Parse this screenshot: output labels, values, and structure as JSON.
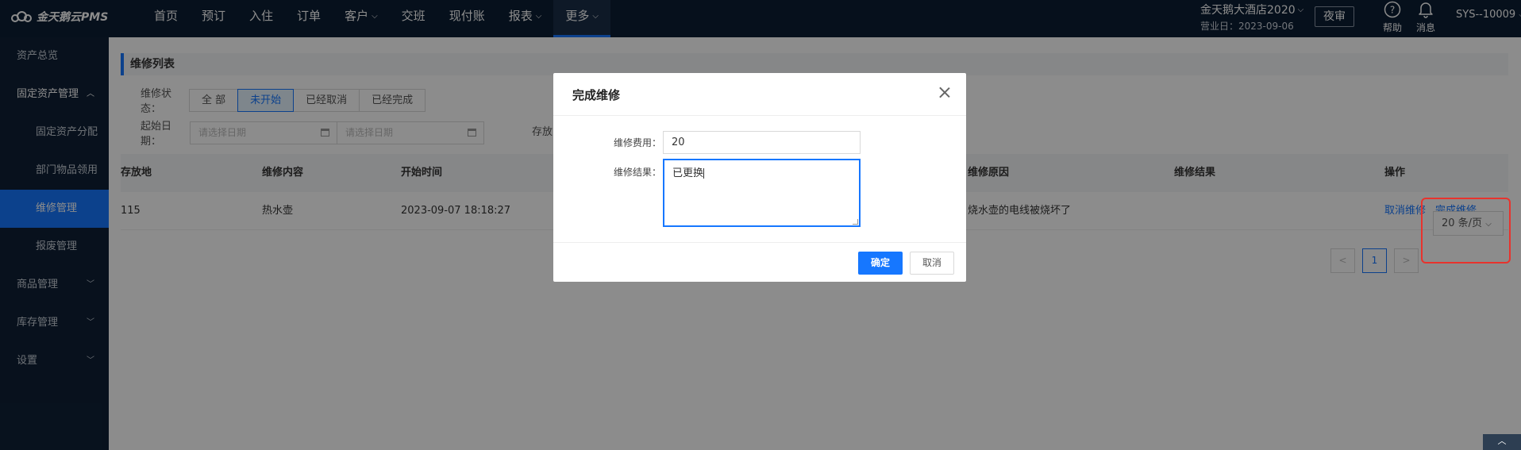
{
  "brand": {
    "name": "金天鹅云PMS"
  },
  "nav": [
    {
      "label": "首页",
      "has_dropdown": false
    },
    {
      "label": "预订",
      "has_dropdown": false
    },
    {
      "label": "入住",
      "has_dropdown": false
    },
    {
      "label": "订单",
      "has_dropdown": false
    },
    {
      "label": "客户",
      "has_dropdown": true
    },
    {
      "label": "交班",
      "has_dropdown": false
    },
    {
      "label": "现付账",
      "has_dropdown": false
    },
    {
      "label": "报表",
      "has_dropdown": true
    },
    {
      "label": "更多",
      "has_dropdown": true,
      "active": true
    }
  ],
  "header": {
    "hotel_name": "金天鹅大酒店2020",
    "business_date": "营业日：2023-09-06",
    "night_audit": "夜审",
    "help_label": "帮助",
    "message_label": "消息",
    "user": "SYS--10009"
  },
  "sidebar": {
    "items": [
      {
        "label": "资产总览"
      },
      {
        "label": "固定资产管理",
        "expanded": true
      },
      {
        "label": "固定资产分配",
        "sub": true
      },
      {
        "label": "部门物品领用",
        "sub": true
      },
      {
        "label": "维修管理",
        "sub": true,
        "active": true
      },
      {
        "label": "报废管理",
        "sub": true
      },
      {
        "label": "商品管理",
        "collapsible": true
      },
      {
        "label": "库存管理",
        "collapsible": true
      },
      {
        "label": "设置",
        "collapsible": true
      }
    ]
  },
  "page": {
    "title": "维修列表",
    "status_label": "维修状态：",
    "status_options": [
      "全 部",
      "未开始",
      "已经取消",
      "已经完成"
    ],
    "status_selected": "未开始",
    "start_date_label": "起始日期：",
    "date_placeholder_1": "请选择日期",
    "date_placeholder_2": "请选择日期",
    "place_label": "存放"
  },
  "table": {
    "columns": [
      "存放地",
      "维修内容",
      "开始时间",
      "维修原因",
      "维修结果",
      "操作"
    ],
    "rows": [
      {
        "place": "115",
        "content": "热水壶",
        "start_time": "2023-09-07 18:18:27",
        "reason": "烧水壶的电线被烧坏了",
        "result": "",
        "actions": [
          "取消维修",
          "完成维修"
        ]
      }
    ]
  },
  "pagination": {
    "prev": "<",
    "current": "1",
    "next": ">",
    "page_size": "20 条/页"
  },
  "modal": {
    "title": "完成维修",
    "fee_label": "维修费用：",
    "fee_value": "20",
    "result_label": "维修结果：",
    "result_value": "已更换",
    "ok_label": "确定",
    "cancel_label": "取消"
  },
  "colors": {
    "primary": "#1677ff",
    "topbar": "#0c1e33",
    "sidebar": "#0f2036",
    "highlight": "#e8332d"
  }
}
